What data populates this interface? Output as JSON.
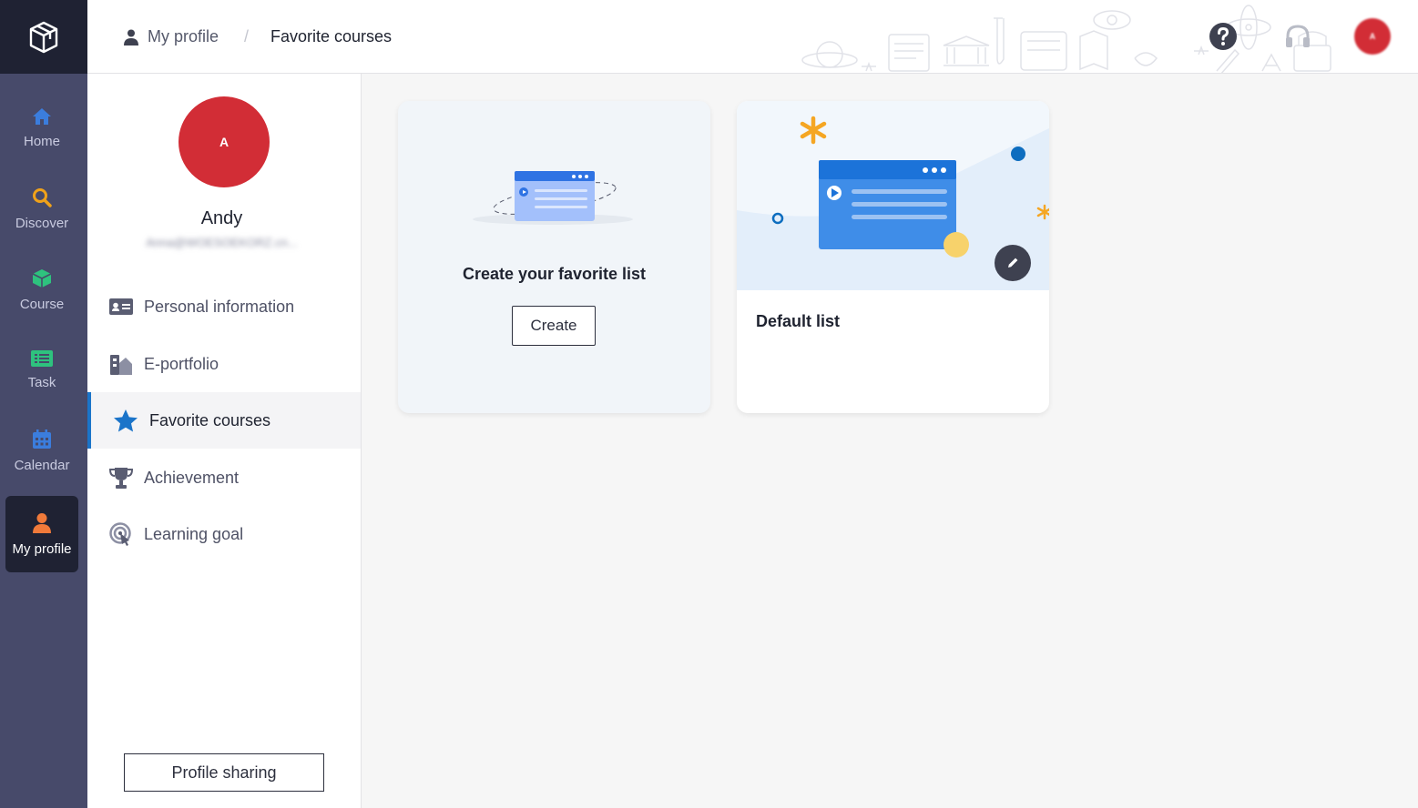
{
  "nav": {
    "items": [
      {
        "label": "Home",
        "icon": "home-icon",
        "color": "#3b7ddd"
      },
      {
        "label": "Discover",
        "icon": "search-icon",
        "color": "#f0a21a"
      },
      {
        "label": "Course",
        "icon": "cube-icon",
        "color": "#2ec27e"
      },
      {
        "label": "Task",
        "icon": "list-icon",
        "color": "#2ec27e"
      },
      {
        "label": "Calendar",
        "icon": "calendar-icon",
        "color": "#3b7ddd"
      },
      {
        "label": "My profile",
        "icon": "person-icon",
        "color": "#f07a3a",
        "active": true
      }
    ]
  },
  "breadcrumb": {
    "parent": "My profile",
    "separator": "/",
    "current": "Favorite courses"
  },
  "profile": {
    "avatar_initial": "A",
    "avatar_color": "#d22d36",
    "name": "Andy",
    "email": "Anna@WOESOEKORZ.cn..."
  },
  "menu": {
    "items": [
      {
        "label": "Personal information",
        "icon": "id-card-icon"
      },
      {
        "label": "E-portfolio",
        "icon": "portfolio-icon"
      },
      {
        "label": "Favorite courses",
        "icon": "star-icon",
        "active": true
      },
      {
        "label": "Achievement",
        "icon": "trophy-icon"
      },
      {
        "label": "Learning goal",
        "icon": "target-icon"
      }
    ],
    "share_label": "Profile sharing"
  },
  "cards": {
    "create": {
      "title": "Create your favorite list",
      "button": "Create"
    },
    "default": {
      "title": "Default list"
    }
  },
  "colors": {
    "rail": "#474a6a",
    "rail_dark": "#1f2233",
    "accent": "#1b74c9"
  }
}
